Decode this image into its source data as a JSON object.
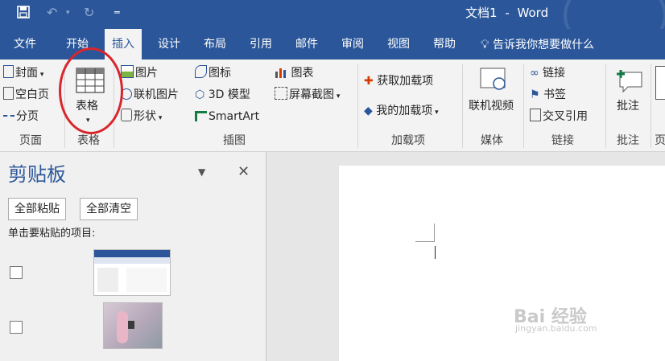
{
  "title": {
    "doc": "文档1",
    "sep": "-",
    "app": "Word"
  },
  "qat": {
    "save_icon": "save-icon",
    "undo_icon": "undo-icon",
    "redo_icon": "redo-icon",
    "customize_icon": "customize-qat-icon"
  },
  "tabs": [
    "文件",
    "开始",
    "插入",
    "设计",
    "布局",
    "引用",
    "邮件",
    "审阅",
    "视图",
    "帮助"
  ],
  "active_tab": "插入",
  "tell_me": "告诉我你想要做什么",
  "ribbon": {
    "pages": {
      "cover": "封面",
      "blank": "空白页",
      "break": "分页",
      "group": "页面"
    },
    "table": {
      "label": "表格",
      "group": "表格"
    },
    "illustrations": {
      "picture": "图片",
      "online_picture": "联机图片",
      "shapes": "形状",
      "icons": "图标",
      "model3d": "3D 模型",
      "smartart": "SmartArt",
      "chart": "图表",
      "screenshot": "屏幕截图",
      "group": "插图"
    },
    "addins": {
      "get": "获取加载项",
      "mine": "我的加载项",
      "group": "加载项"
    },
    "media": {
      "video": "联机视频",
      "group": "媒体"
    },
    "links": {
      "link": "链接",
      "bookmark": "书签",
      "crossref": "交叉引用",
      "group": "链接"
    },
    "comments": {
      "comment": "批注",
      "group": "批注"
    },
    "header": {
      "group": "页"
    }
  },
  "clipboard": {
    "title": "剪贴板",
    "paste_all": "全部粘贴",
    "clear_all": "全部清空",
    "hint": "单击要粘贴的项目:"
  },
  "watermark": {
    "main": "Bai 经验",
    "sub": "jingyan.baidu.com"
  },
  "colors": {
    "accent": "#2b579a",
    "annotation": "#d9262c"
  }
}
